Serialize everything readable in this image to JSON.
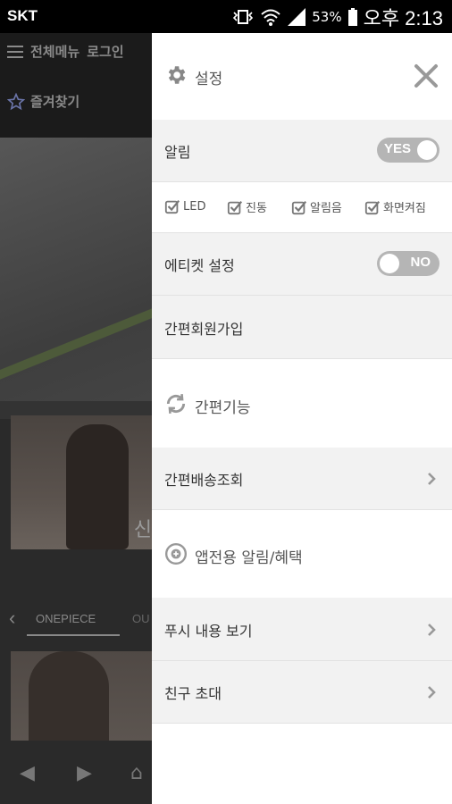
{
  "status_bar": {
    "carrier": "SKT",
    "battery_percent": "53%",
    "time": "오후 2:13"
  },
  "background_app": {
    "menu_label": "전체메뉴",
    "login_label": "로그인",
    "favorites_label": "즐겨찾기",
    "tabs": [
      "ONEPIECE",
      "OU"
    ],
    "photo_text": "신"
  },
  "drawer": {
    "header": {
      "title": "설정"
    },
    "notifications": {
      "label": "알림",
      "toggle_text": "YES",
      "enabled": true
    },
    "options": [
      {
        "label": "LED",
        "checked": true
      },
      {
        "label": "진동",
        "checked": true
      },
      {
        "label": "알림음",
        "checked": true
      },
      {
        "label": "화면켜짐",
        "checked": true
      }
    ],
    "etiquette": {
      "label": "에티켓 설정",
      "toggle_text": "NO",
      "enabled": false
    },
    "simple_signup": {
      "label": "간편회원가입"
    },
    "simple_features": {
      "title": "간편기능"
    },
    "delivery_lookup": {
      "label": "간편배송조회"
    },
    "app_notices": {
      "title": "앱전용 알림/혜택"
    },
    "push_view": {
      "label": "푸시 내용 보기"
    },
    "invite": {
      "label": "친구 초대"
    }
  }
}
